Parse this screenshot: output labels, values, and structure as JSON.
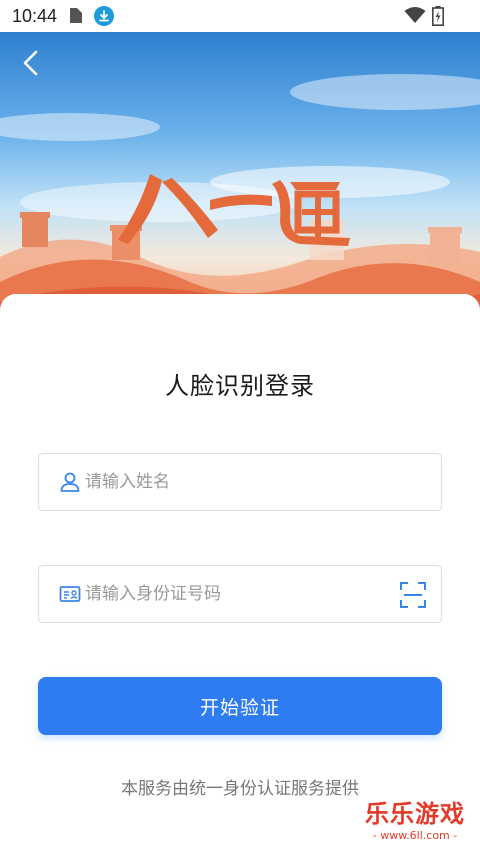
{
  "status_bar": {
    "time": "10:44",
    "icons": [
      "file-icon",
      "download-icon",
      "wifi-icon",
      "battery-icon"
    ]
  },
  "banner": {
    "logo_text": "八一通",
    "back_icon": "chevron-left-icon"
  },
  "login": {
    "title": "人脸识别登录",
    "name_field": {
      "placeholder": "请输入姓名",
      "value": "",
      "icon": "user-icon"
    },
    "id_field": {
      "placeholder": "请输入身份证号码",
      "value": "",
      "icon": "id-card-icon",
      "scan_icon": "scan-icon"
    },
    "verify_button": "开始验证",
    "footer_note": "本服务由统一身份认证服务提供"
  },
  "watermark": {
    "title": "乐乐游戏",
    "url": "- www.6ll.com -"
  },
  "colors": {
    "primary": "#2f7bf1",
    "icon_blue": "#3a86e8",
    "watermark_red": "#e23b2a"
  }
}
